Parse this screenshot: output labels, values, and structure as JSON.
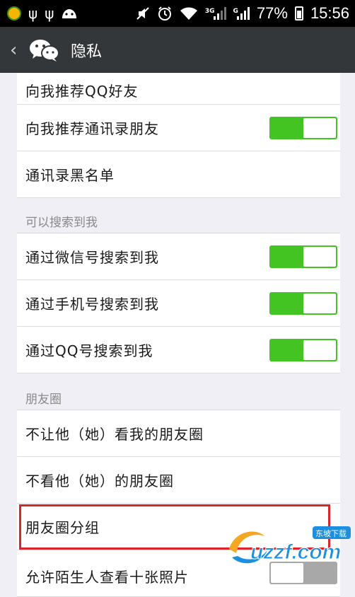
{
  "statusbar": {
    "network_a": "3G",
    "network_b": "G",
    "battery": "77%",
    "time": "15:56"
  },
  "header": {
    "title": "隐私"
  },
  "rows": [
    {
      "label": "向我推荐QQ好友",
      "toggle": "on"
    },
    {
      "label": "向我推荐通讯录朋友",
      "toggle": "on"
    },
    {
      "label": "通讯录黑名单"
    },
    {
      "label": "通过微信号搜索到我",
      "toggle": "on"
    },
    {
      "label": "通过手机号搜索到我",
      "toggle": "on"
    },
    {
      "label": "通过QQ号搜索到我",
      "toggle": "on"
    },
    {
      "label": "不让他（她）看我的朋友圈"
    },
    {
      "label": "不看他（她）的朋友圈"
    },
    {
      "label": "朋友圈分组"
    },
    {
      "label": "允许陌生人查看十张照片",
      "toggle": "off"
    }
  ],
  "sections": {
    "search": "可以搜索到我",
    "moments": "朋友圈"
  },
  "watermark": {
    "brand": "uzzf.com",
    "badge": "东坡下载"
  }
}
